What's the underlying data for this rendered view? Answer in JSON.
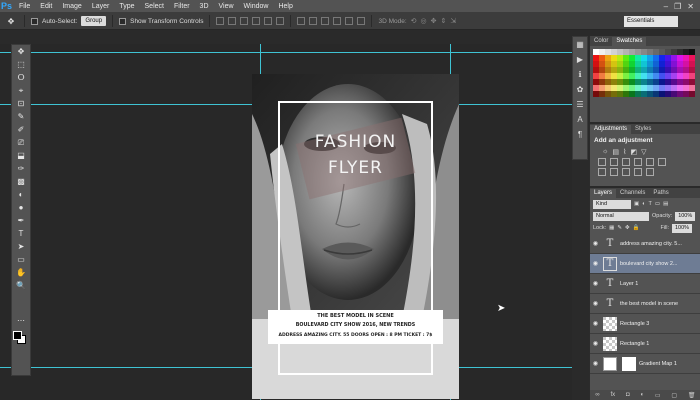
{
  "menubar": {
    "logo": "Ps",
    "items": [
      "File",
      "Edit",
      "Image",
      "Layer",
      "Type",
      "Select",
      "Filter",
      "3D",
      "View",
      "Window",
      "Help"
    ],
    "window_controls": [
      "–",
      "❐",
      "✕"
    ]
  },
  "options_bar": {
    "auto_select_label": "Auto-Select:",
    "auto_select_value": "Group",
    "transform_label": "Show Transform Controls",
    "mode_3d_label": "3D Mode:",
    "workspace": "Essentials"
  },
  "tools": [
    "✥",
    "⬚",
    "ⵔ",
    "⌖",
    "⊡",
    "✎",
    "✐",
    "⎚",
    "⬓",
    "✑",
    "▩",
    "◐",
    "●",
    "✒",
    "T",
    "➤",
    "▭",
    "✋",
    "🔍",
    "⋯"
  ],
  "flyer": {
    "title_line1": "FASHION",
    "title_line2": "FLYER",
    "info_line1": "THE BEST MODEL IN SCENE",
    "info_line2": "BOULEVARD CITY SHOW 2016, NEW TRENDS",
    "info_line3": "ADDRESS AMAZING CITY. 55 DOORS OPEN : 8 PM TICKET : 7$"
  },
  "panels": {
    "color_tabs": [
      "Color",
      "Swatches"
    ],
    "adjust_tabs": [
      "Adjustments",
      "Styles"
    ],
    "adjust_title": "Add an adjustment",
    "layers_tabs": [
      "Layers",
      "Channels",
      "Paths"
    ],
    "kind_label": "Kind",
    "blend_mode": "Normal",
    "opacity_label": "Opacity:",
    "opacity_value": "100%",
    "lock_label": "Lock:",
    "fill_label": "Fill:",
    "fill_value": "100%"
  },
  "layers": [
    {
      "name": "address amazing city. 5...",
      "kind": "text",
      "selected": false
    },
    {
      "name": "boulevard city show 2...",
      "kind": "text",
      "selected": true
    },
    {
      "name": "Layer 1",
      "kind": "text",
      "selected": false
    },
    {
      "name": "the best model in scene",
      "kind": "text",
      "selected": false
    },
    {
      "name": "Rectangle 3",
      "kind": "shape",
      "selected": false
    },
    {
      "name": "Rectangle 1",
      "kind": "shape",
      "selected": false
    },
    {
      "name": "Gradient Map 1",
      "kind": "adjust",
      "selected": false
    }
  ],
  "colors": {
    "guide": "#3fc3d4",
    "selected_layer": "#6e7c94",
    "panel_bg": "#535353",
    "canvas_bg": "#282828"
  }
}
